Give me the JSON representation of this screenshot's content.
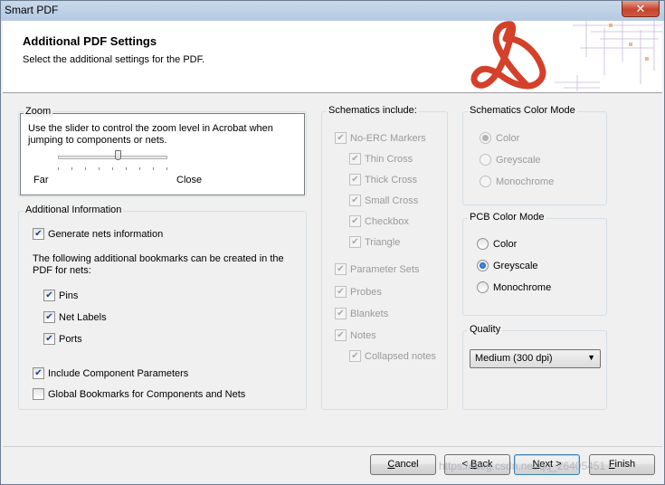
{
  "window": {
    "title": "Smart PDF",
    "close": "✕"
  },
  "header": {
    "title": "Additional PDF Settings",
    "subtitle": "Select the additional settings for the PDF."
  },
  "zoom": {
    "title": "Zoom",
    "description": "Use the slider to control the zoom level in Acrobat when jumping to components or nets.",
    "far_label": "Far",
    "close_label": "Close",
    "slider_level": 0.55
  },
  "additional_info": {
    "title": "Additional Information",
    "generate_nets": {
      "label": "Generate nets information",
      "checked": true
    },
    "bookmarks_text": "The following additional bookmarks can be created in the PDF for nets:",
    "pins": {
      "label": "Pins",
      "checked": true
    },
    "net_labels": {
      "label": "Net Labels",
      "checked": true
    },
    "ports": {
      "label": "Ports",
      "checked": true
    },
    "include_params": {
      "label": "Include Component Parameters",
      "checked": true
    },
    "global_bookmarks": {
      "label": "Global Bookmarks for Components and Nets",
      "checked": false
    }
  },
  "schematics_include": {
    "title": "Schematics include:",
    "no_erc": "No-ERC Markers",
    "thin_cross": "Thin Cross",
    "thick_cross": "Thick Cross",
    "small_cross": "Small Cross",
    "checkbox": "Checkbox",
    "triangle": "Triangle",
    "parameter_sets": "Parameter Sets",
    "probes": "Probes",
    "blankets": "Blankets",
    "notes": "Notes",
    "collapsed_notes": "Collapsed notes"
  },
  "schematics_color_mode": {
    "title": "Schematics Color Mode",
    "color": "Color",
    "greyscale": "Greyscale",
    "monochrome": "Monochrome",
    "selected": "color"
  },
  "pcb_color_mode": {
    "title": "PCB Color Mode",
    "color": "Color",
    "greyscale": "Greyscale",
    "monochrome": "Monochrome",
    "selected": "greyscale"
  },
  "quality": {
    "title": "Quality",
    "selected": "Medium (300 dpi)"
  },
  "buttons": {
    "cancel_u": "C",
    "cancel_rest": "ancel",
    "back_pre": "< ",
    "back_u": "B",
    "back_rest": "ack",
    "next_u": "N",
    "next_rest": "ext >",
    "finish_u": "F",
    "finish_rest": "inish"
  },
  "watermark": "https://blog.csdn.net/qq_26405451",
  "colors": {
    "accent": "#d4402a",
    "titlebar": "#c9d9ec"
  }
}
